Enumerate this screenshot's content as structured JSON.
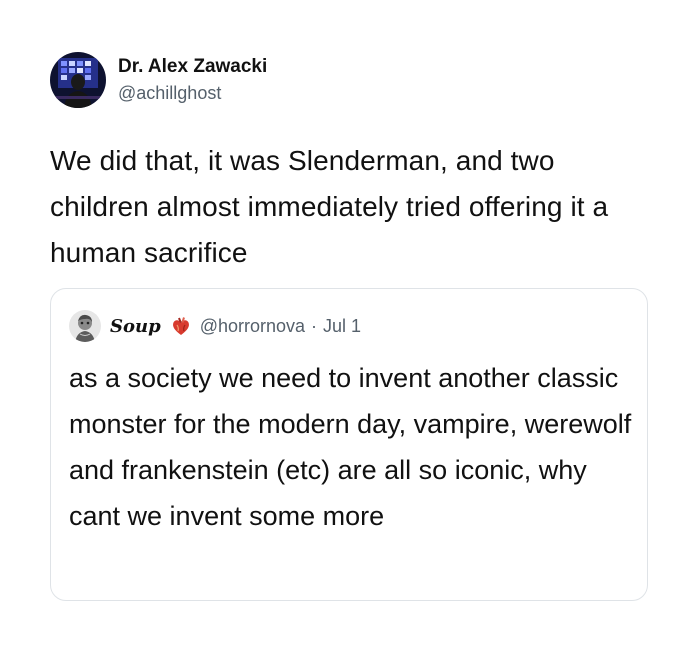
{
  "tweet": {
    "author": {
      "display_name": "Dr. Alex Zawacki",
      "handle": "@achillghost",
      "avatar_icon": "profile-photo-icon"
    },
    "text": "We did that, it was Slenderman, and two children almost immediately tried offering it a human sacrifice"
  },
  "quoted_tweet": {
    "author": {
      "display_name": "Soup",
      "handle": "@horrornova",
      "avatar_icon": "profile-photo-icon",
      "name_emoji": "anatomical-heart-emoji"
    },
    "separator": "·",
    "date": "Jul 1",
    "text": "as a society we need to invent another classic monster for the modern day, vampire, werewolf and frankenstein (etc) are all so iconic, why cant we invent some more"
  },
  "colors": {
    "text_primary": "#111111",
    "text_secondary": "#55606b",
    "card_border": "#dfe3e7",
    "background": "#ffffff"
  }
}
